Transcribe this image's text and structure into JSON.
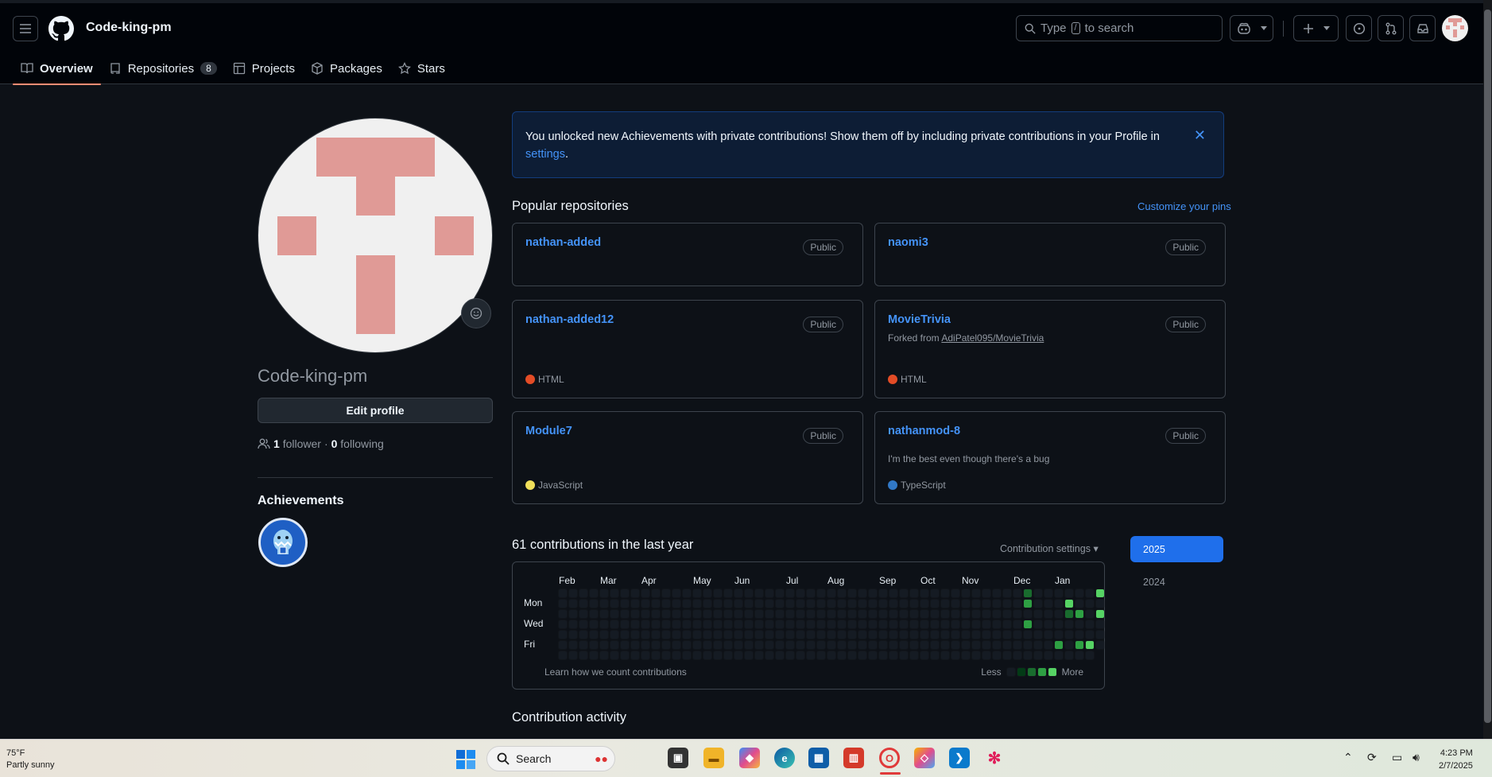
{
  "header": {
    "username": "Code-king-pm",
    "search_prefix": "Type",
    "search_key": "/",
    "search_suffix": "to search"
  },
  "tabs": [
    {
      "label": "Overview"
    },
    {
      "label": "Repositories",
      "count": "8"
    },
    {
      "label": "Projects"
    },
    {
      "label": "Packages"
    },
    {
      "label": "Stars"
    }
  ],
  "profile": {
    "name": "Code-king-pm",
    "edit_label": "Edit profile",
    "followers": "1",
    "followers_label": "follower",
    "sep": "·",
    "following": "0",
    "following_label": "following",
    "achievements_title": "Achievements"
  },
  "banner": {
    "text": "You unlocked new Achievements with private contributions! Show them off by including private contributions in your Profile in",
    "link": "settings",
    "end": "."
  },
  "popular": {
    "title": "Popular repositories",
    "customize": "Customize your pins",
    "repos": [
      {
        "name": "nathan-added",
        "visibility": "Public",
        "desc": "",
        "lang": "",
        "lang_color": ""
      },
      {
        "name": "naomi3",
        "visibility": "Public",
        "desc": "",
        "lang": "",
        "lang_color": ""
      },
      {
        "name": "nathan-added12",
        "visibility": "Public",
        "desc": "",
        "lang": "HTML",
        "lang_color": "#e34c26"
      },
      {
        "name": "MovieTrivia",
        "visibility": "Public",
        "fork_prefix": "Forked from",
        "fork_src": "AdiPatel095/MovieTrivia",
        "lang": "HTML",
        "lang_color": "#e34c26"
      },
      {
        "name": "Module7",
        "visibility": "Public",
        "desc": "",
        "lang": "JavaScript",
        "lang_color": "#f1e05a"
      },
      {
        "name": "nathanmod-8",
        "visibility": "Public",
        "desc": "I'm the best even though there's a bug",
        "lang": "TypeScript",
        "lang_color": "#3178c6"
      }
    ]
  },
  "contributions": {
    "title": "61 contributions in the last year",
    "settings": "Contribution settings",
    "months": [
      "Feb",
      "Mar",
      "Apr",
      "May",
      "Jun",
      "Jul",
      "Aug",
      "Sep",
      "Oct",
      "Nov",
      "Dec",
      "Jan"
    ],
    "days": [
      "Mon",
      "Wed",
      "Fri"
    ],
    "learn": "Learn how we count contributions",
    "less": "Less",
    "more": "More",
    "years": [
      "2025",
      "2024"
    ],
    "colors": {
      "empty": "#151b23",
      "l1": "#033a16",
      "l2": "#196c2e",
      "l3": "#2ea043",
      "l4": "#56d364"
    },
    "active_cells": [
      {
        "week": 45,
        "day": 0,
        "level": 2
      },
      {
        "week": 45,
        "day": 1,
        "level": 3
      },
      {
        "week": 45,
        "day": 3,
        "level": 3
      },
      {
        "week": 49,
        "day": 1,
        "level": 4
      },
      {
        "week": 49,
        "day": 2,
        "level": 2
      },
      {
        "week": 50,
        "day": 2,
        "level": 3
      },
      {
        "week": 48,
        "day": 5,
        "level": 3
      },
      {
        "week": 50,
        "day": 5,
        "level": 3
      },
      {
        "week": 51,
        "day": 5,
        "level": 4
      },
      {
        "week": 52,
        "day": 0,
        "level": 4
      },
      {
        "week": 52,
        "day": 2,
        "level": 4
      }
    ]
  },
  "activity": {
    "title": "Contribution activity"
  },
  "taskbar": {
    "temp": "75°F",
    "weather": "Partly sunny",
    "search": "Search",
    "time": "4:23 PM",
    "date": "2/7/2025"
  }
}
